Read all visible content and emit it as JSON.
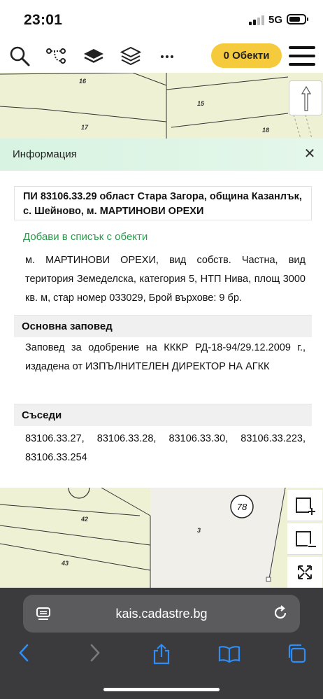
{
  "status_bar": {
    "time": "23:01",
    "network": "5G"
  },
  "toolbar": {
    "objects_label": "0 Обекти"
  },
  "map": {
    "top_labels": [
      "16",
      "15",
      "17",
      "18"
    ],
    "bottom_labels": [
      "42",
      "43",
      "3"
    ],
    "circle_label": "78"
  },
  "info": {
    "header_title": "Информация",
    "parcel_title": "ПИ 83106.33.29 област Стара Загора, община Казанлък, с. Шейново, м. МАРТИНОВИ ОРЕХИ",
    "add_link": "Добави в списък с обекти",
    "description": "м. МАРТИНОВИ ОРЕХИ, вид собств. Частна, вид територия Земеделска, категория 5, НТП Нива, площ 3000 кв. м, стар номер 033029, Брой върхове: 9 бр.",
    "order_heading": "Основна заповед",
    "order_text": "Заповед за одобрение на КККР РД-18-94/29.12.2009 г., издадена от ИЗПЪЛНИТЕЛЕН ДИРЕКТОР НА АГКК",
    "neighbors_heading": "Съседи",
    "neighbors_text": "83106.33.27, 83106.33.28, 83106.33.30, 83106.33.223, 83106.33.254"
  },
  "browser": {
    "url": "kais.cadastre.bg"
  },
  "colors": {
    "accent_yellow": "#f6ca3d",
    "link_green": "#2a9b4a",
    "map_fill": "#eef1d3",
    "map_line": "#3a3a3a",
    "header_green": "#d8f3e2"
  }
}
